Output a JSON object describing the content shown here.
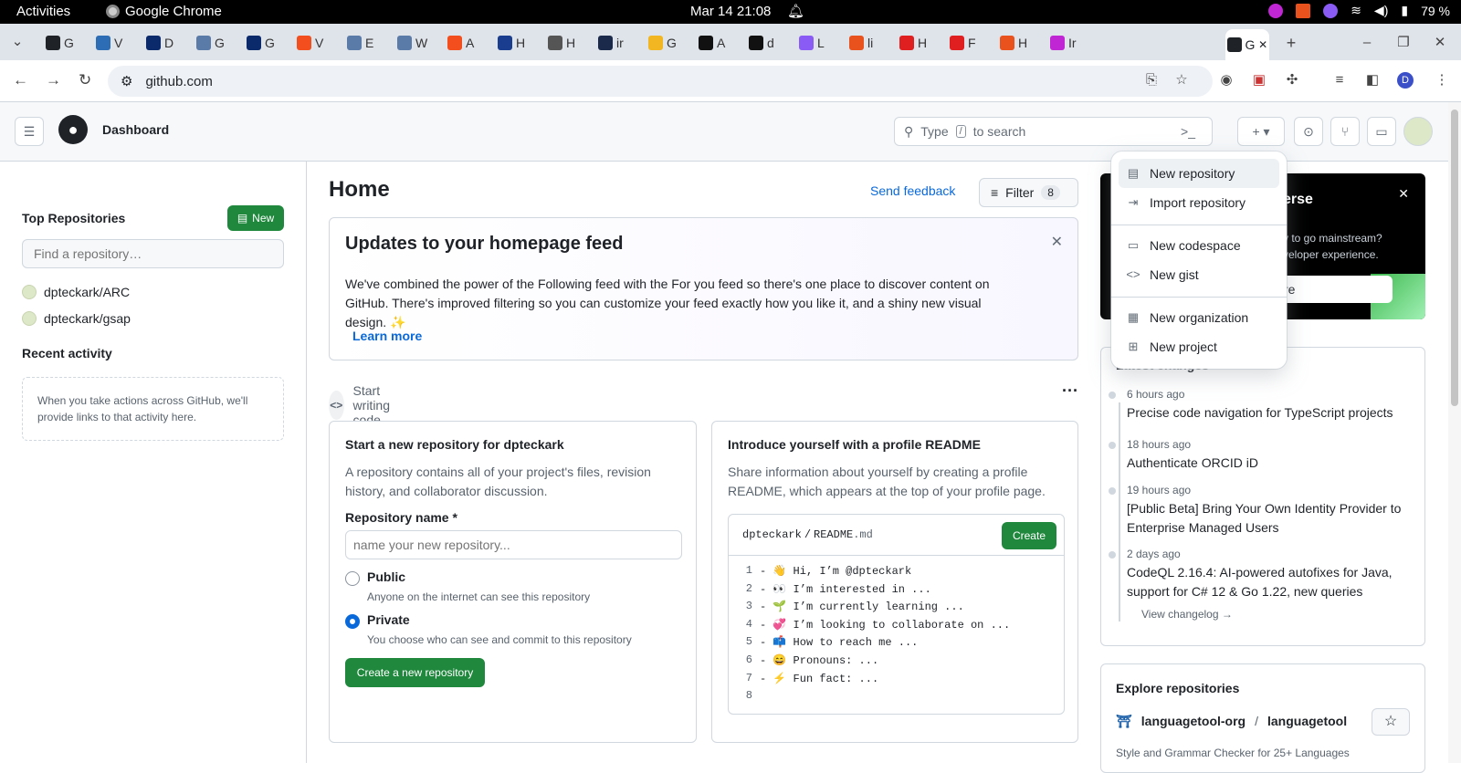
{
  "os": {
    "activities": "Activities",
    "app_name": "Google Chrome",
    "clock": "Mar 14  21:08",
    "battery": "79 %"
  },
  "tabs": [
    {
      "letter": "G",
      "color": "#1f2328"
    },
    {
      "letter": "V",
      "color": "#2d6db5"
    },
    {
      "letter": "D",
      "color": "#0b2a6b"
    },
    {
      "letter": "G",
      "color": "#5a7aa8"
    },
    {
      "letter": "G",
      "color": "#0b2a6b"
    },
    {
      "letter": "V",
      "color": "#f24e1e"
    },
    {
      "letter": "E",
      "color": "#5a7aa8"
    },
    {
      "letter": "W",
      "color": "#5a7aa8"
    },
    {
      "letter": "A",
      "color": "#f24e1e"
    },
    {
      "letter": "H",
      "color": "#1b3d8f"
    },
    {
      "letter": "H",
      "color": "#555"
    },
    {
      "letter": "ir",
      "color": "#1b2a4a"
    },
    {
      "letter": "G",
      "color": "#f2b622"
    },
    {
      "letter": "A",
      "color": "#111"
    },
    {
      "letter": "d",
      "color": "#111"
    },
    {
      "letter": "L",
      "color": "#8a5cf5"
    },
    {
      "letter": "li",
      "color": "#e9511d"
    },
    {
      "letter": "H",
      "color": "#e02020"
    },
    {
      "letter": "F",
      "color": "#e02020"
    },
    {
      "letter": "H",
      "color": "#e9511d"
    },
    {
      "letter": "Ir",
      "color": "#c026d3"
    }
  ],
  "active_tab": {
    "letter": "G"
  },
  "address": {
    "url": "github.com"
  },
  "header": {
    "title": "Dashboard",
    "search_placeholder": "Type",
    "search_key": "/",
    "search_suffix": "to search"
  },
  "sidebar": {
    "top_repos_heading": "Top Repositories",
    "new_label": "New",
    "find_placeholder": "Find a repository…",
    "repos": [
      "dpteckark/ARC",
      "dpteckark/gsap"
    ],
    "recent_heading": "Recent activity",
    "recent_empty": "When you take actions across GitHub, we'll provide links to that activity here."
  },
  "main": {
    "title": "Home",
    "send_feedback": "Send feedback",
    "filter_label": "Filter",
    "filter_count": "8",
    "update": {
      "title": "Updates to your homepage feed",
      "body": "We've combined the power of the Following feed with the For you feed so there's one place to discover content on GitHub. There's improved filtering so you can customize your feed exactly how you like it, and a shiny new visual design. ✨",
      "learn_more": "Learn more"
    },
    "start_writing": "Start writing code",
    "new_repo_card": {
      "title": "Start a new repository for dpteckark",
      "desc": "A repository contains all of your project's files, revision history, and collaborator discussion.",
      "name_label": "Repository name *",
      "name_placeholder": "name your new repository...",
      "public_label": "Public",
      "public_desc": "Anyone on the internet can see this repository",
      "private_label": "Private",
      "private_desc": "You choose who can see and commit to this repository",
      "create_button": "Create a new repository"
    },
    "readme_card": {
      "title": "Introduce yourself with a profile README",
      "desc": "Share information about yourself by creating a profile README, which appears at the top of your profile page.",
      "path_user": "dpteckark",
      "path_sep": "/",
      "path_file": "README",
      "path_ext": ".md",
      "create": "Create",
      "lines": [
        {
          "n": "1",
          "text": "- 👋 Hi, I’m @dpteckark"
        },
        {
          "n": "2",
          "text": "- 👀 I’m interested in ..."
        },
        {
          "n": "3",
          "text": "- 🌱 I’m currently learning ..."
        },
        {
          "n": "4",
          "text": "- 💞️ I’m looking to collaborate on ..."
        },
        {
          "n": "5",
          "text": "- 📫 How to reach me ..."
        },
        {
          "n": "6",
          "text": "- 😄 Pronouns: ..."
        },
        {
          "n": "7",
          "text": "- ⚡ Fun fact: ..."
        },
        {
          "n": "8",
          "text": ""
        }
      ]
    }
  },
  "promo": {
    "title_fragment": "erse",
    "line1": "y to go mainstream?",
    "line2": "veloper experience.",
    "button_fragment": "re"
  },
  "changes": {
    "heading": "Latest changes",
    "items": [
      {
        "date": "6 hours ago",
        "title": "Precise code navigation for TypeScript projects"
      },
      {
        "date": "18 hours ago",
        "title": "Authenticate ORCID iD"
      },
      {
        "date": "19 hours ago",
        "title": "[Public Beta] Bring Your Own Identity Provider to Enterprise Managed Users"
      },
      {
        "date": "2 days ago",
        "title": "CodeQL 2.16.4: AI-powered autofixes for Java, support for C# 12 & Go 1.22, new queries"
      }
    ],
    "view_changelog": "View changelog →"
  },
  "explore": {
    "heading": "Explore repositories",
    "owner": "languagetool-org",
    "sep": "/",
    "repo": "languagetool",
    "desc": "Style and Grammar Checker for 25+ Languages"
  },
  "menu": {
    "items": [
      {
        "label": "New repository",
        "icon": "repo-icon"
      },
      {
        "label": "Import repository",
        "icon": "import-icon"
      },
      {
        "label": "New codespace",
        "icon": "codespace-icon"
      },
      {
        "label": "New gist",
        "icon": "code-icon"
      },
      {
        "label": "New organization",
        "icon": "organization-icon"
      },
      {
        "label": "New project",
        "icon": "project-table-icon"
      }
    ]
  },
  "colors": {
    "primary_green": "#1f883d",
    "link_blue": "#0969da"
  }
}
